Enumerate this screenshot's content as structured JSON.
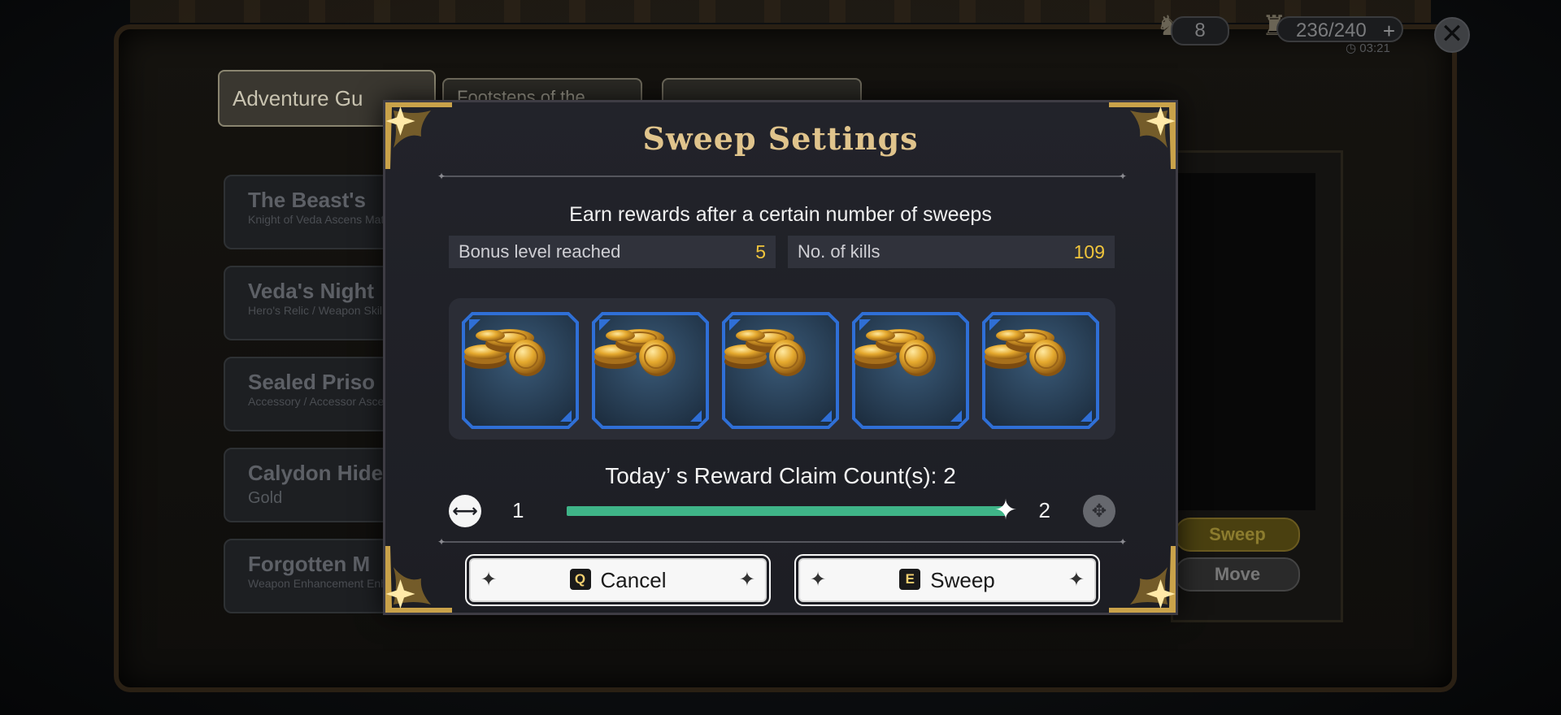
{
  "background": {
    "tabs": [
      "Adventure Gu",
      "Footsteps of the",
      ""
    ],
    "dungeon_list": [
      {
        "title": "The Beast's",
        "subtitle": "Knight of Veda Ascens Materials"
      },
      {
        "title": "Veda's Night",
        "subtitle": "Hero's Relic / Weapon Skill"
      },
      {
        "title": "Sealed Priso",
        "subtitle": "Accessory / Accessor Ascension"
      },
      {
        "title": "Calydon Hide",
        "subtitle": "Gold"
      },
      {
        "title": "Forgotten M",
        "subtitle": "Weapon Enhancement Enhancement"
      }
    ],
    "sweep_label": "Sweep",
    "move_label": "Move"
  },
  "hud": {
    "tickets": "8",
    "stamina": "236/240",
    "timer": "03:21"
  },
  "modal": {
    "title": "Sweep Settings",
    "subtitle": "Earn rewards after a certain number of sweeps",
    "bonus_label": "Bonus level reached",
    "bonus_value": "5",
    "kills_label": "No. of kills",
    "kills_value": "109",
    "rewards": [
      {
        "icon": "gold-coins-icon"
      },
      {
        "icon": "gold-coins-icon"
      },
      {
        "icon": "gold-coins-icon"
      },
      {
        "icon": "gold-coins-icon"
      },
      {
        "icon": "gold-coins-icon"
      }
    ],
    "claim_text": "Today’ s Reward Claim Count(s): 2",
    "slider": {
      "min_label": "1",
      "max_label": "2",
      "min": 1,
      "max": 2,
      "value": 2
    },
    "cancel_key": "Q",
    "cancel_label": "Cancel",
    "sweep_key": "E",
    "sweep_label": "Sweep"
  },
  "colors": {
    "title_gold": "#e0c48c",
    "value_yellow": "#f0c53c",
    "slider_fill": "#3fb488",
    "slot_border": "#2f6fd6"
  }
}
